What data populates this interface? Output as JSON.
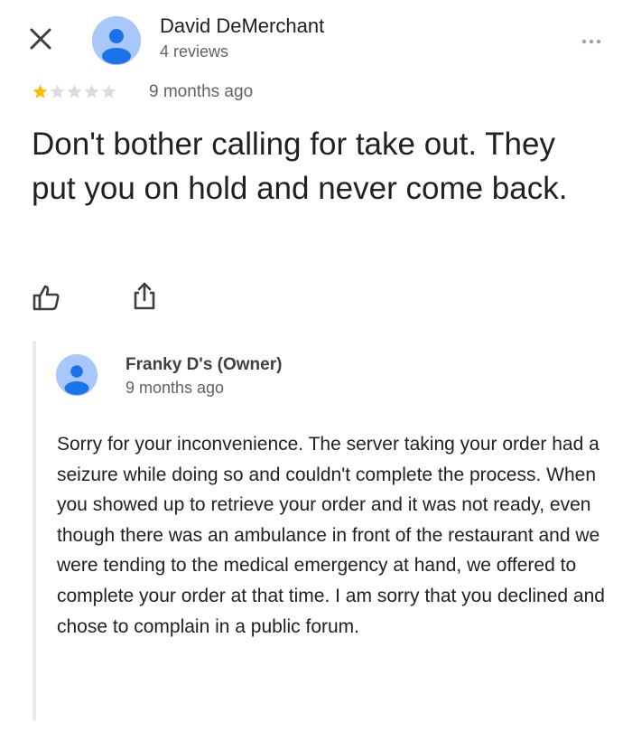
{
  "review": {
    "author_name": "David DeMerchant",
    "author_reviews": "4 reviews",
    "rating": 1,
    "rating_max": 5,
    "time": "9 months ago",
    "text": "Don't bother calling for take out. They put you on hold and never come back."
  },
  "owner_response": {
    "name": "Franky D's (Owner)",
    "time": "9 months ago",
    "text": "Sorry for your inconvenience.  The server taking your order had a seizure while doing so and couldn't complete the process.  When you showed up to retrieve your order and it was not ready, even though there was an ambulance in front of the restaurant and we were tending to the medical emergency at hand, we offered to complete your order at that time.  I am sorry that you declined and chose to complain in a public forum."
  },
  "icons": {
    "close": "close-icon",
    "more": "more-horizontal-icon",
    "like": "thumbs-up-icon",
    "share": "share-icon",
    "avatar": "person-icon",
    "star": "star-icon"
  },
  "colors": {
    "star_filled": "#fbbc04",
    "star_empty": "#dadce0",
    "avatar_bg": "#a8c7fa",
    "avatar_fg": "#1a73e8"
  }
}
